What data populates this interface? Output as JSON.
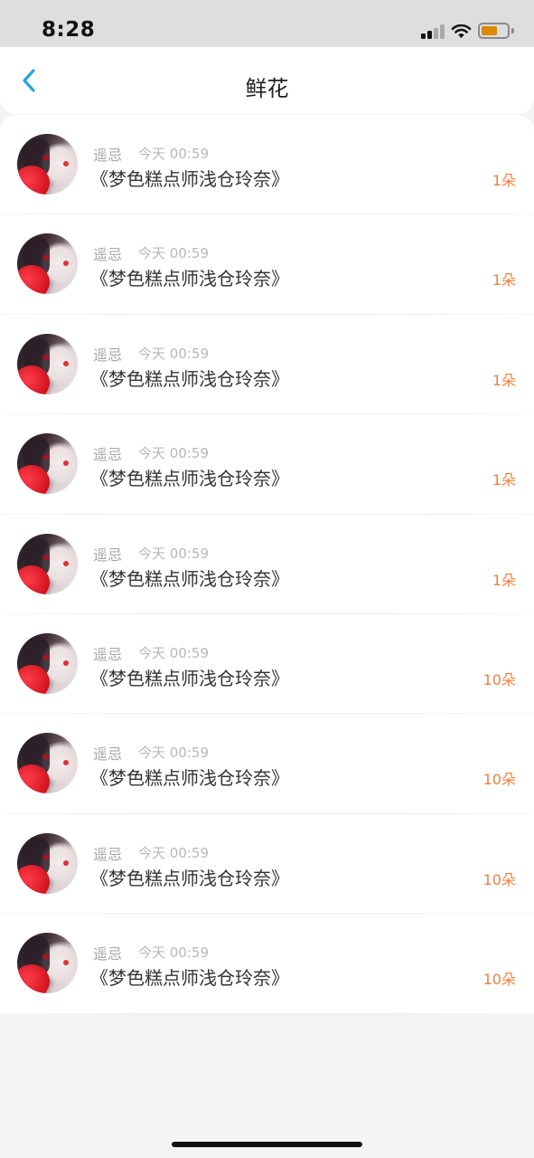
{
  "status_bar": {
    "time": "8:28",
    "icons": [
      "cellular-signal-icon",
      "wifi-icon",
      "battery-icon"
    ],
    "battery_color": "#d88a00"
  },
  "nav": {
    "back_icon": "chevron-left-icon",
    "title": "鲜花",
    "accent": "#2aa3e0"
  },
  "list": {
    "count_color": "#ef7f3c",
    "items": [
      {
        "user": "遥忌",
        "time": "今天 00:59",
        "title": "《梦色糕点师浅仓玲奈》",
        "count": "1朵"
      },
      {
        "user": "遥忌",
        "time": "今天 00:59",
        "title": "《梦色糕点师浅仓玲奈》",
        "count": "1朵"
      },
      {
        "user": "遥忌",
        "time": "今天 00:59",
        "title": "《梦色糕点师浅仓玲奈》",
        "count": "1朵"
      },
      {
        "user": "遥忌",
        "time": "今天 00:59",
        "title": "《梦色糕点师浅仓玲奈》",
        "count": "1朵"
      },
      {
        "user": "遥忌",
        "time": "今天 00:59",
        "title": "《梦色糕点师浅仓玲奈》",
        "count": "1朵"
      },
      {
        "user": "遥忌",
        "time": "今天 00:59",
        "title": "《梦色糕点师浅仓玲奈》",
        "count": "10朵"
      },
      {
        "user": "遥忌",
        "time": "今天 00:59",
        "title": "《梦色糕点师浅仓玲奈》",
        "count": "10朵"
      },
      {
        "user": "遥忌",
        "time": "今天 00:59",
        "title": "《梦色糕点师浅仓玲奈》",
        "count": "10朵"
      },
      {
        "user": "遥忌",
        "time": "今天 00:59",
        "title": "《梦色糕点师浅仓玲奈》",
        "count": "10朵"
      }
    ]
  }
}
